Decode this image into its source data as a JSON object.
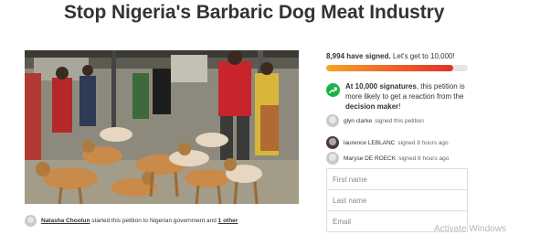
{
  "petition": {
    "title": "Stop Nigeria's Barbaric Dog Meat Industry"
  },
  "photo": {
    "subject": "Group of tan and white dogs tied together at an outdoor market with people standing behind"
  },
  "author_line": {
    "name": "Natasha Choolun",
    "middle": " started this petition to Nigerian government and ",
    "other": "1 other"
  },
  "signatures": {
    "count_text": "8,994 have signed.",
    "goal_text": " Let's get to 10,000!",
    "progress_fraction": 0.8994
  },
  "milestone": {
    "bold_lead": "At 10,000 signatures",
    "middle": ", this petition is more likely to get a reaction from the ",
    "bold_tail": "decision maker",
    "end": "!"
  },
  "recent_signers": [
    {
      "name": "glyn clarke",
      "action": "signed this petition"
    },
    {
      "name": "laurence LEBLANC",
      "action": "signed 8 hours ago"
    },
    {
      "name": "Maryse DE ROECK",
      "action": "signed 8 hours ago"
    }
  ],
  "form": {
    "first_name_placeholder": "First name",
    "last_name_placeholder": "Last name",
    "email_placeholder": "Email"
  },
  "watermark": {
    "text": "Activate Windows"
  },
  "colors": {
    "progress_start": "#f5a623",
    "progress_end": "#e0322b",
    "milestone_icon": "#1bb24b"
  }
}
